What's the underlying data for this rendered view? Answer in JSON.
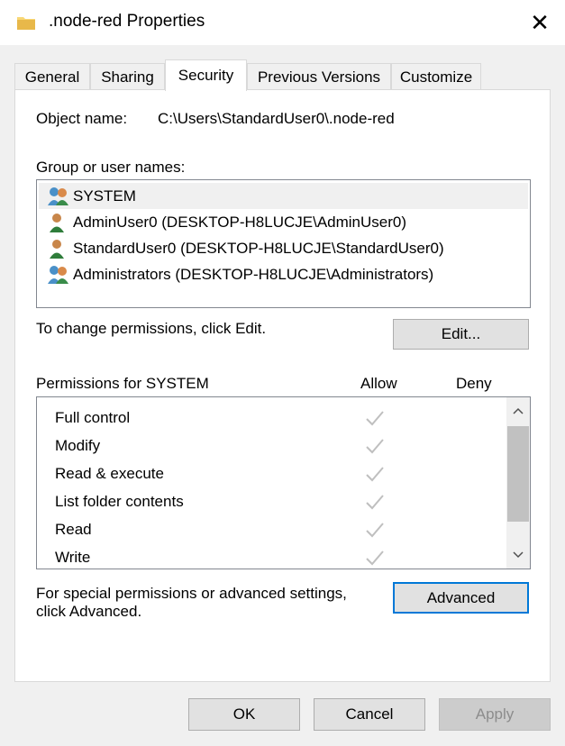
{
  "window": {
    "title": ".node-red Properties",
    "close_glyph": "✕"
  },
  "tabs": [
    {
      "label": "General"
    },
    {
      "label": "Sharing"
    },
    {
      "label": "Security"
    },
    {
      "label": "Previous Versions"
    },
    {
      "label": "Customize"
    }
  ],
  "security": {
    "object_name_label": "Object name:",
    "object_name_value": "C:\\Users\\StandardUser0\\.node-red",
    "group_label": "Group or user names:",
    "users": [
      {
        "name": "SYSTEM",
        "icon": "group-users-icon"
      },
      {
        "name": "AdminUser0 (DESKTOP-H8LUCJE\\AdminUser0)",
        "icon": "user-icon"
      },
      {
        "name": "StandardUser0 (DESKTOP-H8LUCJE\\StandardUser0)",
        "icon": "user-icon"
      },
      {
        "name": "Administrators (DESKTOP-H8LUCJE\\Administrators)",
        "icon": "group-users-icon"
      }
    ],
    "change_text": "To change permissions, click Edit.",
    "edit_button": "Edit...",
    "permissions_for": "Permissions for SYSTEM",
    "allow_header": "Allow",
    "deny_header": "Deny",
    "permissions": [
      {
        "name": "Full control",
        "allow": true,
        "deny": false
      },
      {
        "name": "Modify",
        "allow": true,
        "deny": false
      },
      {
        "name": "Read & execute",
        "allow": true,
        "deny": false
      },
      {
        "name": "List folder contents",
        "allow": true,
        "deny": false
      },
      {
        "name": "Read",
        "allow": true,
        "deny": false
      },
      {
        "name": "Write",
        "allow": true,
        "deny": false
      }
    ],
    "advanced_text_line1": "For special permissions or advanced settings,",
    "advanced_text_line2": "click Advanced.",
    "advanced_button": "Advanced"
  },
  "footer": {
    "ok": "OK",
    "cancel": "Cancel",
    "apply": "Apply"
  },
  "colors": {
    "accent": "#0078d7",
    "selected_row": "#f0f0f0",
    "check_gray": "#bfbfbf"
  }
}
